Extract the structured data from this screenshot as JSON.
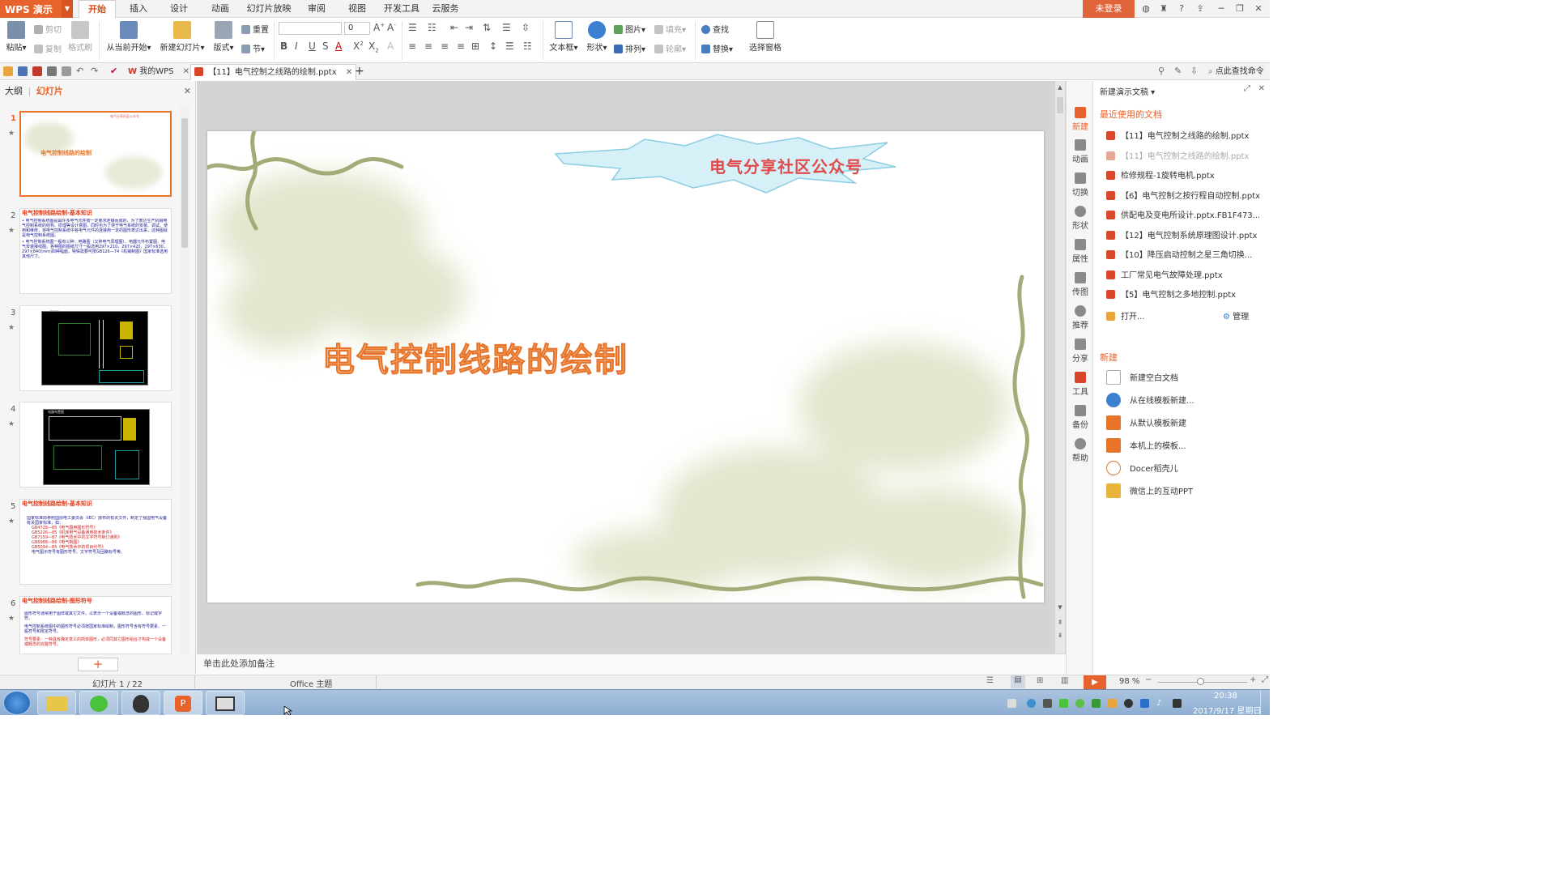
{
  "app": {
    "name": "WPS 演示"
  },
  "ribbon_tabs": [
    "开始",
    "插入",
    "设计",
    "动画",
    "幻灯片放映",
    "审阅",
    "视图",
    "开发工具",
    "云服务"
  ],
  "login_label": "未登录",
  "toolbar": {
    "paste": "粘贴",
    "cut": "剪切",
    "copy": "复制",
    "format_painter": "格式刷",
    "from_current": "从当前开始",
    "new_slide": "新建幻灯片",
    "layout": "版式",
    "reset": "重置",
    "section": "节",
    "font_size": "0",
    "textbox": "文本框",
    "shape": "形状",
    "picture": "图片",
    "fill": "填充",
    "arrange": "排列",
    "outline": "轮廓",
    "find": "查找",
    "replace": "替换",
    "selection_pane": "选择窗格"
  },
  "doc_tabs": [
    "我的WPS",
    "【11】电气控制之线路的绘制.pptx"
  ],
  "search_commands": "点此查找命令",
  "left_panel": {
    "tabs": [
      "大纲",
      "幻灯片"
    ],
    "thumbs": [
      {
        "num": "1",
        "title": "电气控制线路的绘制",
        "banner": "电气分享社区公众号"
      },
      {
        "num": "2",
        "title": "电气控制线路绘制-基本知识",
        "body": [
          "• 电气控制系统图是由许多电气元件按一定要求连接而成的，为了表达生产机械电气控制系统的结构、原理等设计意图，同时也为了便于电气系统的安装、调试、使用和维修，将电气控制系统中各电气元件的连接用一定的图形表达出来，这种图就是电气控制系统图。",
          "• 电气控制系统图一般有三种：电路图（又称电气原理图）、电器元件布置图、电气安装接线图。各种图的图纸尺寸一般选用297×210，297×420，297×630，297×840(mm)四种幅面，特殊需要可按GB126—74《机械制图》国家标准选用其他尺寸。"
        ]
      },
      {
        "num": "3",
        "header": "原理图"
      },
      {
        "num": "4",
        "header": "电路布置图"
      },
      {
        "num": "5",
        "title": "电气控制线路绘制-基本知识",
        "body": [
          "国家标准局参照国际电工委员会（IEC）颁布的有关文件，制定了我国电气设备有关国家标准，如：",
          "GB4728—85《电气图用图形符号》",
          "GB5226—85《机床电气设备通用技术条件》",
          "GB7159—87《电气技术中的文字符号制订通则》",
          "GB6988—86《电气制图》",
          "GB5094—85《电气技术中的项目代号》",
          "电气图示符号有图形符号、文字符号及回路标号等。"
        ]
      },
      {
        "num": "6",
        "title": "电气控制线路绘制-图形符号",
        "body": [
          "图形符号通常用于图样或其它文件，以表示一个设备或概念的图形、标记或字符。",
          "电气控制系统图中的图形符号必须按国家标准绘制，图形符号含有符号要素、一般符号和限定符号。",
          "符号要素：一种具有确定意义的简单图形，必须同其它图形组合才构成一个设备或概念的完整符号。"
        ]
      }
    ]
  },
  "slide": {
    "banner": "电气分享社区公众号",
    "title": "电气控制线路的绘制"
  },
  "notes_placeholder": "单击此处添加备注",
  "task_pane": {
    "header": "新建演示文稿",
    "recent_title": "最近使用的文档",
    "recent": [
      "【11】电气控制之线路的绘制.pptx",
      "【11】电气控制之线路的绘制.pptx",
      "检修规程-1旋转电机.pptx",
      "【6】电气控制之按行程自动控制.pptx",
      "供配电及变电所设计.pptx.FB1F473...",
      "【12】电气控制系统原理图设计.pptx",
      "【10】降压启动控制之星三角切换...",
      "工厂常见电气故障处理.pptx",
      "【5】电气控制之多地控制.pptx"
    ],
    "open": "打开...",
    "manage": "管理",
    "new_title": "新建",
    "new_items": [
      "新建空白文档",
      "从在线模板新建...",
      "从默认模板新建",
      "本机上的模板...",
      "Docer稻壳儿",
      "微信上的互动PPT"
    ]
  },
  "side_icons": [
    "新建",
    "动画",
    "切换",
    "形状",
    "属性",
    "传图",
    "推荐",
    "分享",
    "工具",
    "备份",
    "帮助"
  ],
  "status": {
    "slide_counter": "幻灯片 1 / 22",
    "theme": "Office 主题",
    "zoom": "98 %"
  },
  "taskbar": {
    "time": "20:38",
    "date": "2017/9/17 星期日"
  },
  "colors": {
    "accent": "#e8632b",
    "slide_title": "#e8742a",
    "banner_text": "#e04a4a",
    "banner_fill": "#d6f0f8"
  }
}
